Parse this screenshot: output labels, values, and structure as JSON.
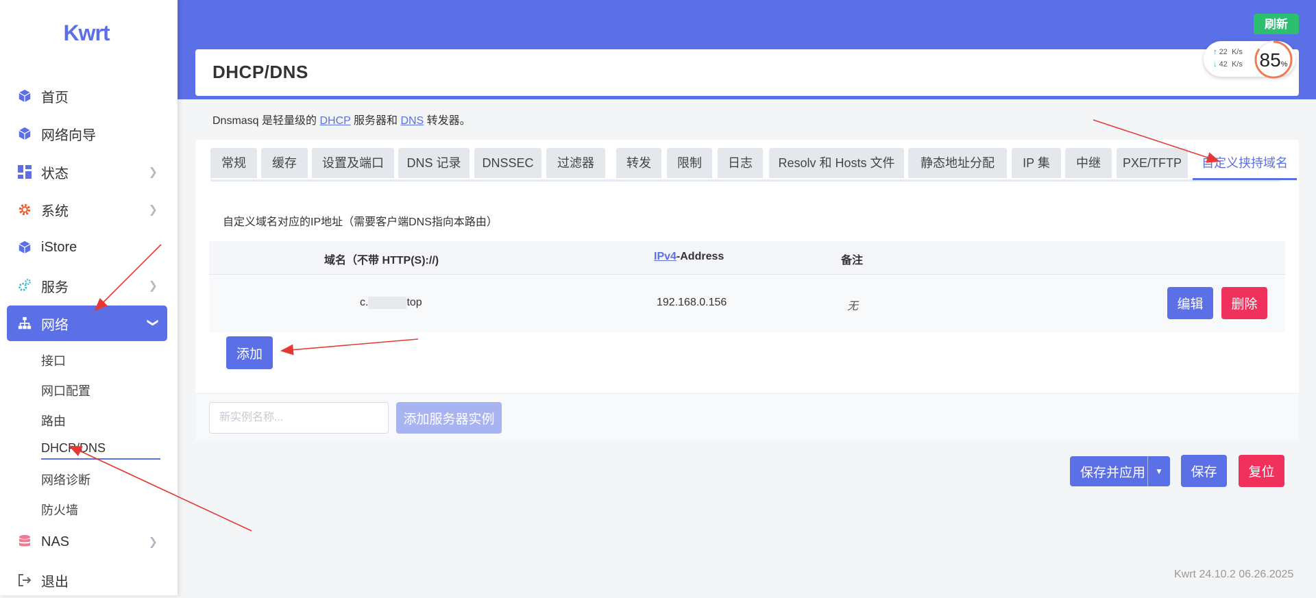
{
  "sidebar": {
    "logo": "Kwrt",
    "items": [
      {
        "label": "首页",
        "icon": "cube-icon"
      },
      {
        "label": "网络向导",
        "icon": "cube-icon"
      },
      {
        "label": "状态",
        "icon": "dashboard-icon"
      },
      {
        "label": "系统",
        "icon": "gear-icon"
      },
      {
        "label": "iStore",
        "icon": "cube-icon"
      },
      {
        "label": "服务",
        "icon": "gears-icon"
      },
      {
        "label": "网络",
        "icon": "network-icon"
      },
      {
        "label": "NAS",
        "icon": "database-icon"
      },
      {
        "label": "退出",
        "icon": "logout-icon"
      }
    ],
    "subitems": [
      "接口",
      "网口配置",
      "路由",
      "DHCP/DNS",
      "网络诊断",
      "防火墙"
    ]
  },
  "header": {
    "refresh_label": "刷新",
    "upload_speed": "22",
    "download_speed": "42",
    "speed_unit": "K/s",
    "gauge_value": "85",
    "gauge_unit": "%"
  },
  "page": {
    "title": "DHCP/DNS",
    "desc_prefix": "Dnsmasq 是轻量级的 ",
    "desc_dhcp": "DHCP",
    "desc_middle": " 服务器和 ",
    "desc_dns": "DNS",
    "desc_suffix": " 转发器。"
  },
  "tabs": [
    "常规",
    "缓存",
    "设置及端口",
    "DNS 记录",
    "DNSSEC",
    "过滤器",
    "转发",
    "限制",
    "日志",
    "Resolv 和 Hosts 文件",
    "静态地址分配",
    "IP 集",
    "中继",
    "PXE/TFTP",
    "自定义挟持域名"
  ],
  "section": {
    "title": "自定义域名对应的IP地址（需要客户端DNS指向本路由）",
    "headers": {
      "domain": "域名（不带 HTTP(S)://)",
      "ipv4_abbr": "IPv4",
      "ipv4_rest": "-Address",
      "note": "备注"
    },
    "rows": [
      {
        "domain_start": "c.",
        "domain_end": "top",
        "ip": "192.168.0.156",
        "note": "无"
      }
    ],
    "edit_label": "编辑",
    "delete_label": "删除",
    "add_label": "添加"
  },
  "instance": {
    "placeholder": "新实例名称...",
    "add_label": "添加服务器实例"
  },
  "actions": {
    "save_apply": "保存并应用",
    "save": "保存",
    "reset": "复位"
  },
  "footer": "Kwrt 24.10.2 06.26.2025",
  "colors": {
    "accent": "#5b6fe6",
    "danger": "#f0315c",
    "success": "#2bbf6f",
    "annotation": "#e53935"
  }
}
